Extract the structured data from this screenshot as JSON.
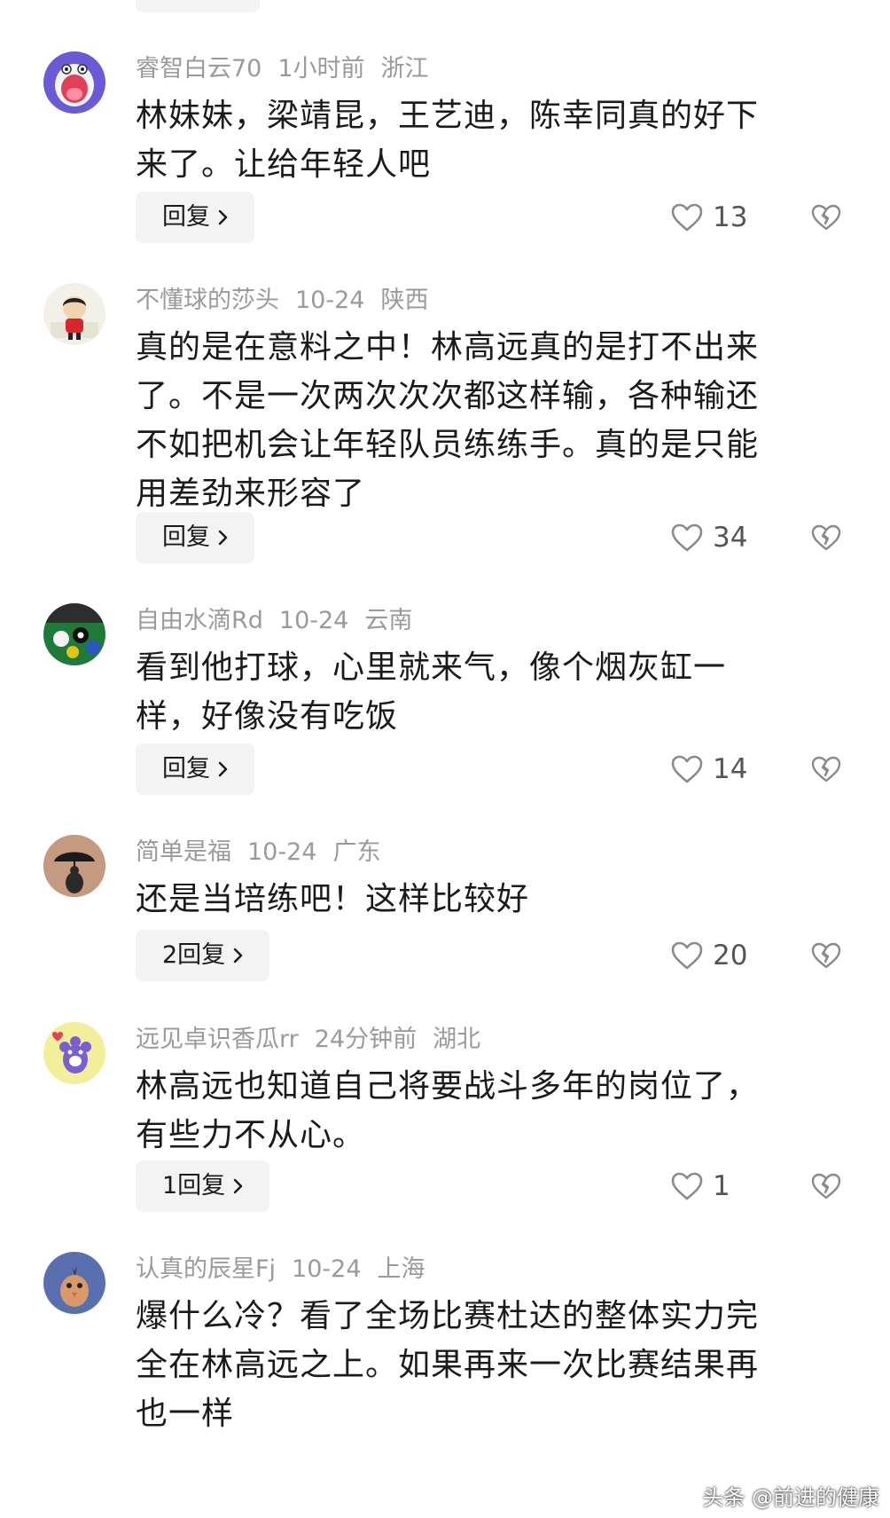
{
  "comments": [
    {
      "user": "睿智白云70",
      "time": "1小时前",
      "location": "浙江",
      "line1": "林妹妹，梁靖昆，王艺迪，陈幸同真的好下",
      "line2": "来了。让给年轻人吧",
      "reply_label": "回复",
      "likes": "13",
      "avatar": "cartoon-mouth-avatar"
    },
    {
      "user": "不懂球的莎头",
      "time": "10-24",
      "location": "陕西",
      "line1": "真的是在意料之中！林高远真的是打不出来",
      "line2": "了。不是一次两次次次都这样输，各种输还",
      "line3": "不如把机会让年轻队员练练手。真的是只能",
      "line4": "用差劲来形容了",
      "reply_label": "回复",
      "likes": "34",
      "avatar": "cartoon-child-avatar"
    },
    {
      "user": "自由水滴Rd",
      "time": "10-24",
      "location": "云南",
      "line1": "看到他打球，心里就来气，像个烟灰缸一",
      "line2": "样，好像没有吃饭",
      "reply_label": "回复",
      "likes": "14",
      "avatar": "billiards-avatar"
    },
    {
      "user": "简单是福",
      "time": "10-24",
      "location": "广东",
      "line1": "还是当培练吧！这样比较好",
      "reply_label": "2回复",
      "likes": "20",
      "avatar": "umbrella-avatar"
    },
    {
      "user": "远见卓识香瓜rr",
      "time": "24分钟前",
      "location": "湖北",
      "line1": "林高远也知道自己将要战斗多年的岗位了，",
      "line2": "有些力不从心。",
      "reply_label": "1回复",
      "likes": "1",
      "avatar": "paw-avatar"
    },
    {
      "user": "认真的辰星Fj",
      "time": "10-24",
      "location": "上海",
      "line1": "爆什么冷？看了全场比赛杜达的整体实力完",
      "line2": "全在林高远之上。如果再来一次比赛结果再",
      "line3": "也一样",
      "avatar": "bird-avatar"
    }
  ],
  "watermark": "头条 @前进的健康",
  "colors": {
    "meta_gray": "#9a9a9a",
    "text": "#1a1a1a",
    "reply_bg": "#f3f3f3",
    "icon_gray": "#8a8a8a"
  }
}
